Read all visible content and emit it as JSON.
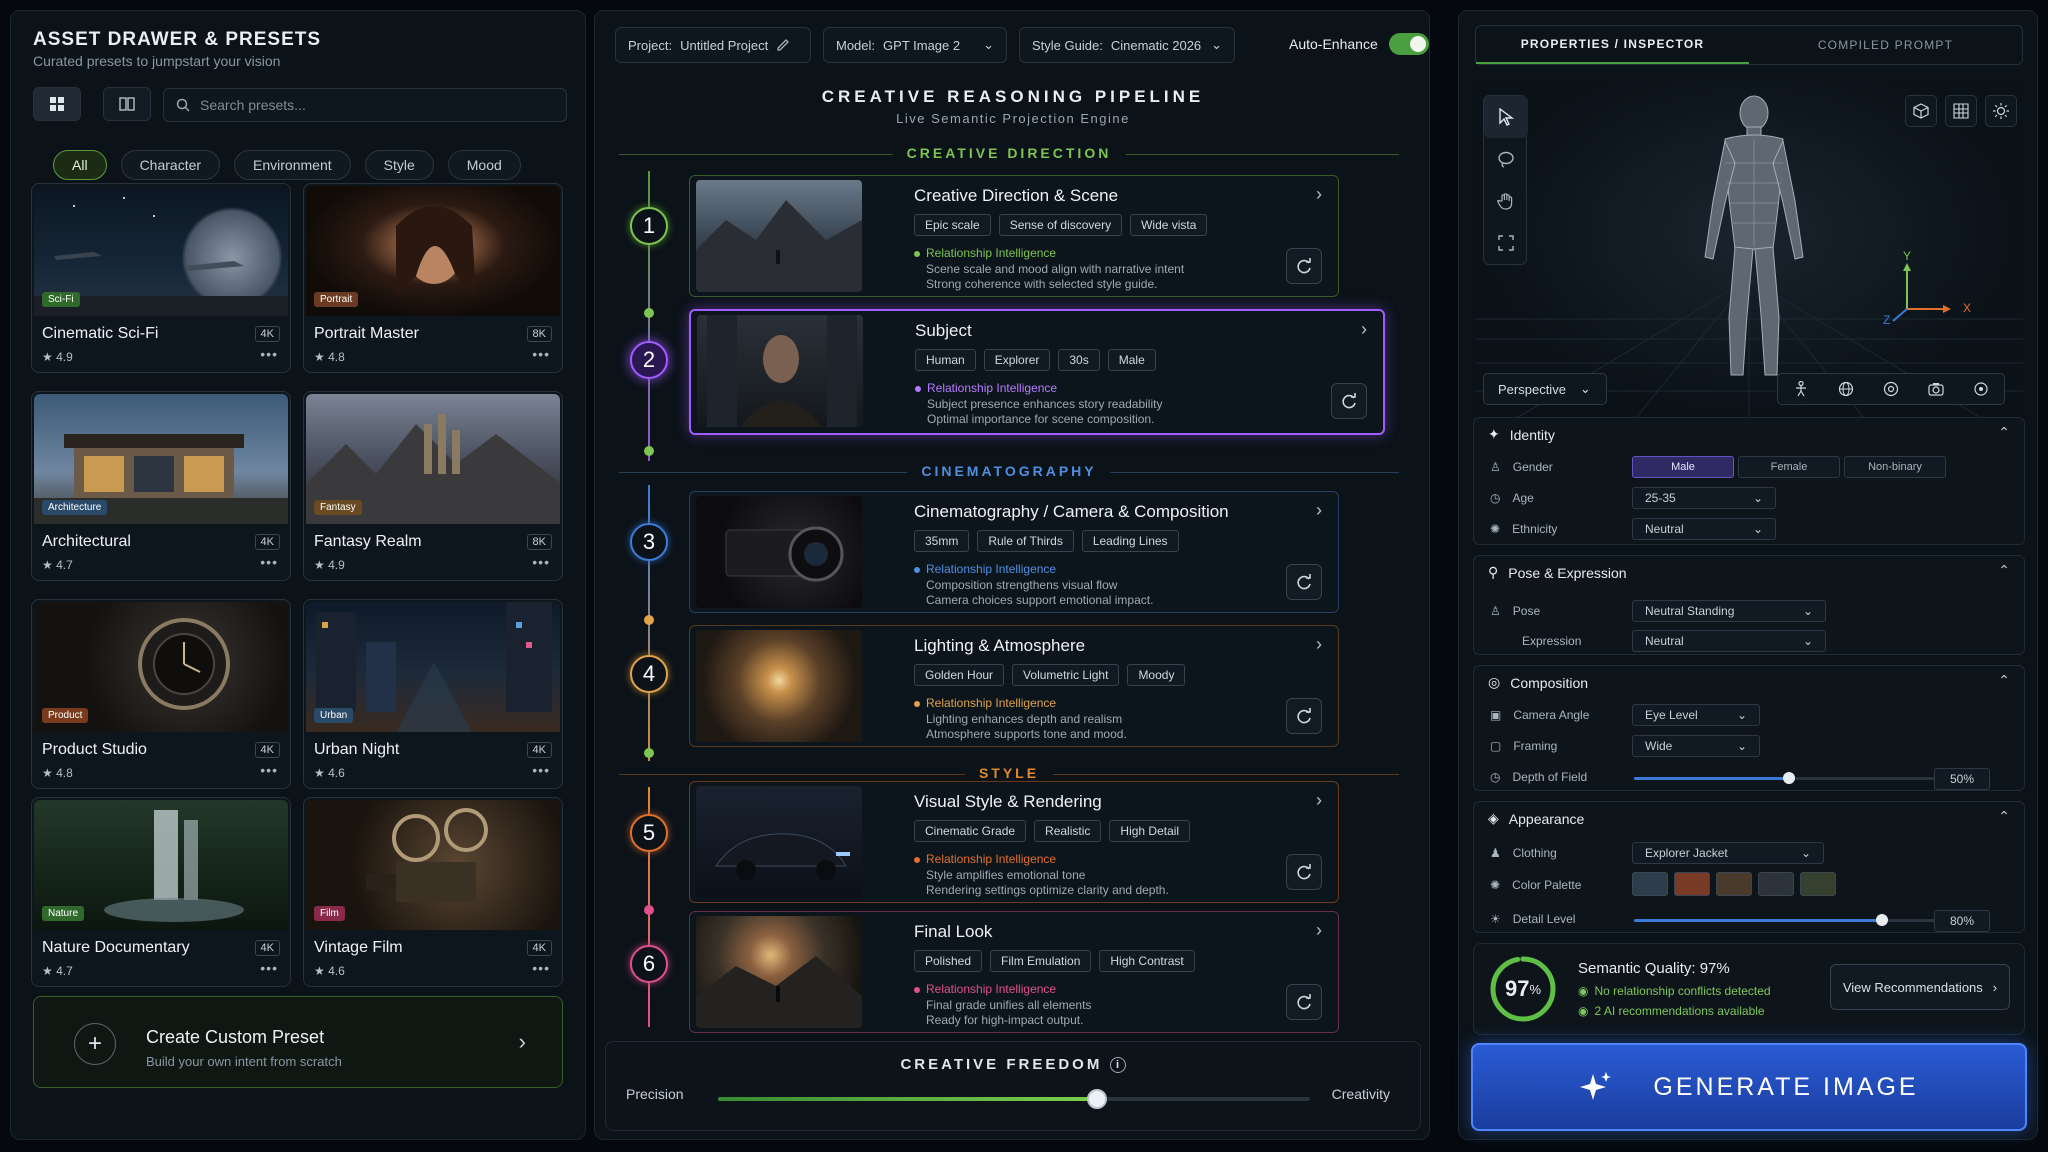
{
  "colors": {
    "accent": "#4aa040",
    "purple": "#a05cff",
    "blue": "#3c7bd8",
    "orange": "#e08a2c",
    "pink": "#e0508c",
    "green": "#7dc452"
  },
  "drawer": {
    "title": "ASSET DRAWER & PRESETS",
    "subtitle": "Curated presets to jumpstart your vision",
    "search_placeholder": "Search presets...",
    "filters": [
      "All",
      "Character",
      "Environment",
      "Style",
      "Mood"
    ],
    "presets": [
      {
        "tag": "Sci-Fi",
        "name": "Cinematic Sci-Fi",
        "res": "4K",
        "rating": "4.9"
      },
      {
        "tag": "Portrait",
        "name": "Portrait Master",
        "res": "8K",
        "rating": "4.8"
      },
      {
        "tag": "Architecture",
        "name": "Architectural",
        "res": "4K",
        "rating": "4.7"
      },
      {
        "tag": "Fantasy",
        "name": "Fantasy Realm",
        "res": "8K",
        "rating": "4.9"
      },
      {
        "tag": "Product",
        "name": "Product Studio",
        "res": "4K",
        "rating": "4.8"
      },
      {
        "tag": "Urban",
        "name": "Urban Night",
        "res": "4K",
        "rating": "4.6"
      },
      {
        "tag": "Nature",
        "name": "Nature Documentary",
        "res": "4K",
        "rating": "4.7"
      },
      {
        "tag": "Film",
        "name": "Vintage Film",
        "res": "4K",
        "rating": "4.6"
      }
    ],
    "custom_title": "Create Custom Preset",
    "custom_sub": "Build your own intent from scratch"
  },
  "topbar": {
    "project_label": "Project:",
    "project_value": "Untitled Project",
    "model_label": "Model:",
    "model_value": "GPT Image 2",
    "style_label": "Style Guide:",
    "style_value": "Cinematic 2026",
    "auto_enhance": "Auto-Enhance"
  },
  "pipeline": {
    "title": "CREATIVE REASONING PIPELINE",
    "subtitle": "Live Semantic Projection Engine",
    "sections": [
      "CREATIVE DIRECTION",
      "CINEMATOGRAPHY",
      "STYLE"
    ],
    "ri_label": "Relationship Intelligence",
    "steps": [
      {
        "num": "1",
        "title": "Creative Direction & Scene",
        "tags": [
          "Epic scale",
          "Sense of discovery",
          "Wide vista"
        ],
        "d1": "Scene scale and mood align with narrative intent",
        "d2": "Strong coherence with selected style guide."
      },
      {
        "num": "2",
        "title": "Subject",
        "tags": [
          "Human",
          "Explorer",
          "30s",
          "Male"
        ],
        "d1": "Subject presence enhances story readability",
        "d2": "Optimal importance for scene composition."
      },
      {
        "num": "3",
        "title": "Cinematography / Camera & Composition",
        "tags": [
          "35mm",
          "Rule of Thirds",
          "Leading Lines"
        ],
        "d1": "Composition strengthens visual flow",
        "d2": "Camera choices support emotional impact."
      },
      {
        "num": "4",
        "title": "Lighting & Atmosphere",
        "tags": [
          "Golden Hour",
          "Volumetric Light",
          "Moody"
        ],
        "d1": "Lighting enhances depth and realism",
        "d2": "Atmosphere supports tone and mood."
      },
      {
        "num": "5",
        "title": "Visual Style & Rendering",
        "tags": [
          "Cinematic Grade",
          "Realistic",
          "High Detail"
        ],
        "d1": "Style amplifies emotional tone",
        "d2": "Rendering settings optimize clarity and depth."
      },
      {
        "num": "6",
        "title": "Final Look",
        "tags": [
          "Polished",
          "Film Emulation",
          "High Contrast"
        ],
        "d1": "Final grade unifies all elements",
        "d2": "Ready for high-impact output."
      }
    ],
    "freedom_title": "CREATIVE FREEDOM",
    "precision": "Precision",
    "creativity": "Creativity",
    "freedom_value": 0.64
  },
  "inspector": {
    "tabs": [
      "PROPERTIES / INSPECTOR",
      "COMPILED PROMPT"
    ],
    "view": "Perspective",
    "axes": {
      "x": "X",
      "y": "Y",
      "z": "Z"
    },
    "identity": {
      "title": "Identity",
      "gender_label": "Gender",
      "genders": [
        "Male",
        "Female",
        "Non-binary"
      ],
      "age_label": "Age",
      "age": "25-35",
      "eth_label": "Ethnicity",
      "eth": "Neutral"
    },
    "pose": {
      "title": "Pose & Expression",
      "pose_label": "Pose",
      "pose": "Neutral Standing",
      "expr_label": "Expression",
      "expr": "Neutral"
    },
    "composition": {
      "title": "Composition",
      "angle_label": "Camera Angle",
      "angle": "Eye Level",
      "framing_label": "Framing",
      "framing": "Wide",
      "dof_label": "Depth of Field",
      "dof": "50%",
      "dof_value": 0.5
    },
    "appearance": {
      "title": "Appearance",
      "clothing_label": "Clothing",
      "clothing": "Explorer Jacket",
      "palette_label": "Color Palette",
      "palette": [
        "#2e3d4c",
        "#7a3b26",
        "#4a3a2c",
        "#2d333b",
        "#35402f"
      ],
      "detail_label": "Detail Level",
      "detail": "80%",
      "detail_value": 0.8
    },
    "quality": {
      "pct": "97",
      "title": "Semantic Quality: 97%",
      "a": "No relationship conflicts detected",
      "b": "2 AI recommendations available",
      "btn": "View Recommendations"
    },
    "generate": "GENERATE IMAGE"
  }
}
